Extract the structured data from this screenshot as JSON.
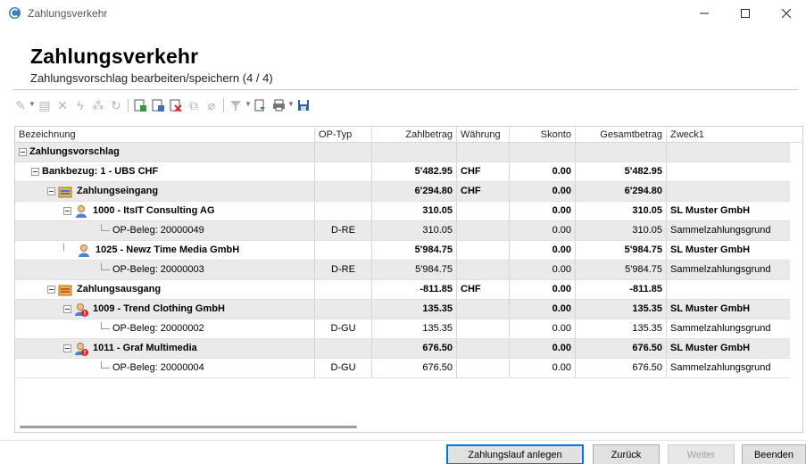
{
  "window": {
    "title": "Zahlungsverkehr",
    "icon": "app-icon"
  },
  "header": {
    "title": "Zahlungsverkehr",
    "subtitle": "Zahlungsvorschlag bearbeiten/speichern (4 / 4)"
  },
  "toolbar": {
    "icons": [
      "wand-icon",
      "document-icon",
      "delete-icon",
      "lightning-icon",
      "split-icon",
      "refresh-icon",
      "export-icon",
      "edit-icon",
      "remove-icon",
      "copy-icon",
      "eraser-icon",
      "filter-icon",
      "import-icon",
      "print-icon",
      "save-icon"
    ]
  },
  "grid": {
    "columns": [
      "Bezeichnung",
      "OP-Typ",
      "Zahlbetrag",
      "Währung",
      "Skonto",
      "Gesamtbetrag",
      "Zweck1"
    ],
    "rows": [
      {
        "name": "Zahlungsvorschlag",
        "op": "",
        "amount": "",
        "cur": "",
        "skonto": "",
        "total": "",
        "purpose": ""
      },
      {
        "name": "Bankbezug: 1 - UBS CHF",
        "op": "",
        "amount": "5'482.95",
        "cur": "CHF",
        "skonto": "0.00",
        "total": "5'482.95",
        "purpose": ""
      },
      {
        "name": "Zahlungseingang",
        "op": "",
        "amount": "6'294.80",
        "cur": "CHF",
        "skonto": "0.00",
        "total": "6'294.80",
        "purpose": ""
      },
      {
        "name": "1000 - ItsIT Consulting AG",
        "op": "",
        "amount": "310.05",
        "cur": "",
        "skonto": "0.00",
        "total": "310.05",
        "purpose": "SL Muster GmbH"
      },
      {
        "name": "OP-Beleg: 20000049",
        "op": "D-RE",
        "amount": "310.05",
        "cur": "",
        "skonto": "0.00",
        "total": "310.05",
        "purpose": "Sammelzahlungsgrund"
      },
      {
        "name": "1025 - Newz Time Media GmbH",
        "op": "",
        "amount": "5'984.75",
        "cur": "",
        "skonto": "0.00",
        "total": "5'984.75",
        "purpose": "SL Muster GmbH"
      },
      {
        "name": "OP-Beleg: 20000003",
        "op": "D-RE",
        "amount": "5'984.75",
        "cur": "",
        "skonto": "0.00",
        "total": "5'984.75",
        "purpose": "Sammelzahlungsgrund"
      },
      {
        "name": "Zahlungsausgang",
        "op": "",
        "amount": "-811.85",
        "cur": "CHF",
        "skonto": "0.00",
        "total": "-811.85",
        "purpose": ""
      },
      {
        "name": "1009 - Trend Clothing GmbH",
        "op": "",
        "amount": "135.35",
        "cur": "",
        "skonto": "0.00",
        "total": "135.35",
        "purpose": "SL Muster GmbH"
      },
      {
        "name": "OP-Beleg: 20000002",
        "op": "D-GU",
        "amount": "135.35",
        "cur": "",
        "skonto": "0.00",
        "total": "135.35",
        "purpose": "Sammelzahlungsgrund"
      },
      {
        "name": "1011 - Graf Multimedia",
        "op": "",
        "amount": "676.50",
        "cur": "",
        "skonto": "0.00",
        "total": "676.50",
        "purpose": "SL Muster GmbH"
      },
      {
        "name": "OP-Beleg: 20000004",
        "op": "D-GU",
        "amount": "676.50",
        "cur": "",
        "skonto": "0.00",
        "total": "676.50",
        "purpose": "Sammelzahlungsgrund"
      }
    ]
  },
  "buttons": {
    "create_run": "Zahlungslauf anlegen",
    "back": "Zurück",
    "next": "Weiter",
    "finish": "Beenden"
  }
}
